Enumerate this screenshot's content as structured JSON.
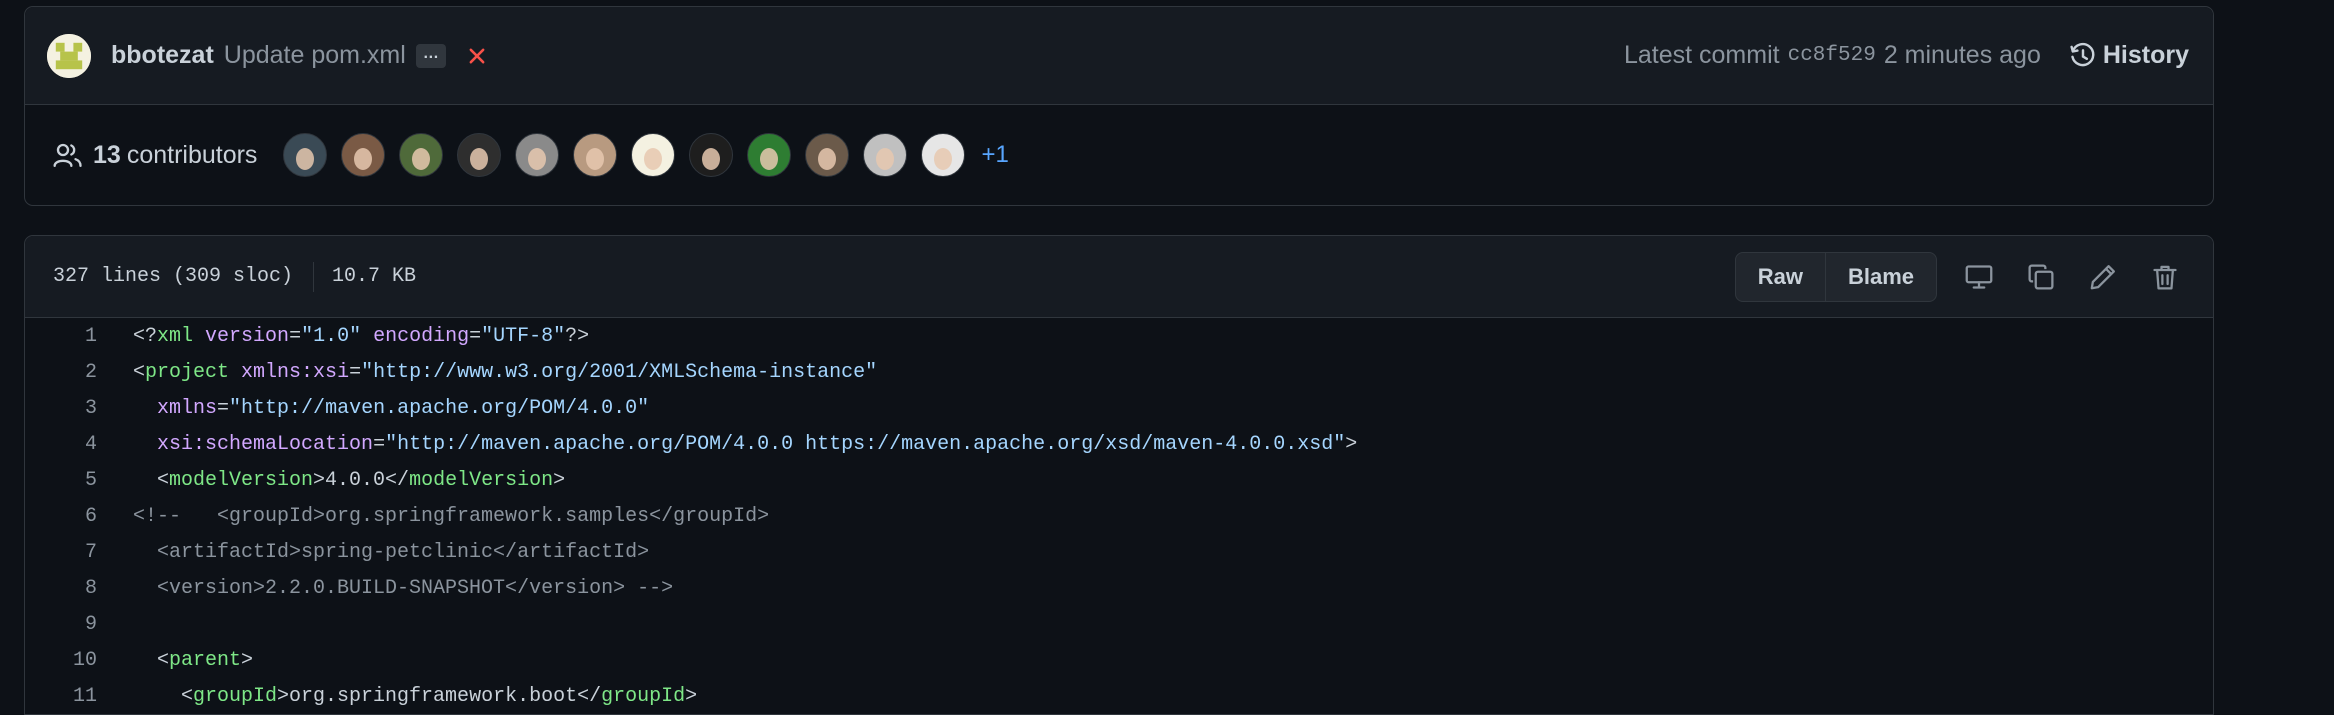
{
  "commit": {
    "author": "bbotezat",
    "message": "Update pom.xml",
    "ellipsis": "…",
    "latest_label": "Latest commit",
    "sha": "cc8f529",
    "time": "2 minutes ago",
    "history_label": "History"
  },
  "contributors": {
    "count": "13",
    "label": "contributors",
    "more": "+1",
    "avatar_colors": [
      "#3a4a55",
      "#7a5a45",
      "#4f6a3a",
      "#2e2e2e",
      "#8a8a8a",
      "#b89a80",
      "#f4f1e1",
      "#1e1e1e",
      "#2e7d32",
      "#6b5a4a",
      "#c0c0c0",
      "#e6e6e6"
    ]
  },
  "file": {
    "lines_info": "327 lines (309 sloc)",
    "size": "10.7 KB",
    "raw_label": "Raw",
    "blame_label": "Blame"
  },
  "code": {
    "lines": [
      {
        "n": "1"
      },
      {
        "n": "2"
      },
      {
        "n": "3"
      },
      {
        "n": "4"
      },
      {
        "n": "5"
      },
      {
        "n": "6"
      },
      {
        "n": "7"
      },
      {
        "n": "8"
      },
      {
        "n": "9"
      },
      {
        "n": "10"
      },
      {
        "n": "11"
      }
    ],
    "l1": {
      "a": "<?",
      "b": "xml",
      "c": " ",
      "d": "version",
      "e": "=",
      "f": "\"1.0\"",
      "g": " ",
      "h": "encoding",
      "i": "=",
      "j": "\"UTF-8\"",
      "k": "?>"
    },
    "l2": {
      "a": "<",
      "b": "project",
      "c": " ",
      "d": "xmlns:xsi",
      "e": "=",
      "f": "\"http://www.w3.org/2001/XMLSchema-instance\""
    },
    "l3": {
      "a": "  ",
      "d": "xmlns",
      "e": "=",
      "f": "\"http://maven.apache.org/POM/4.0.0\""
    },
    "l4": {
      "a": "  ",
      "d": "xsi:schemaLocation",
      "e": "=",
      "f": "\"http://maven.apache.org/POM/4.0.0 https://maven.apache.org/xsd/maven-4.0.0.xsd\"",
      "g": ">"
    },
    "l5": {
      "a": "  <",
      "b": "modelVersion",
      "c": ">4.0.0</",
      "d": "modelVersion",
      "e": ">"
    },
    "l6": {
      "text": "<!--   <groupId>org.springframework.samples</groupId>"
    },
    "l7": {
      "text": "  <artifactId>spring-petclinic</artifactId>"
    },
    "l8": {
      "text": "  <version>2.2.0.BUILD-SNAPSHOT</version> -->"
    },
    "l9": {
      "text": ""
    },
    "l10": {
      "a": "  <",
      "b": "parent",
      "c": ">"
    },
    "l11": {
      "a": "    <",
      "b": "groupId",
      "c": ">org.springframework.boot</",
      "d": "groupId",
      "e": ">"
    }
  }
}
